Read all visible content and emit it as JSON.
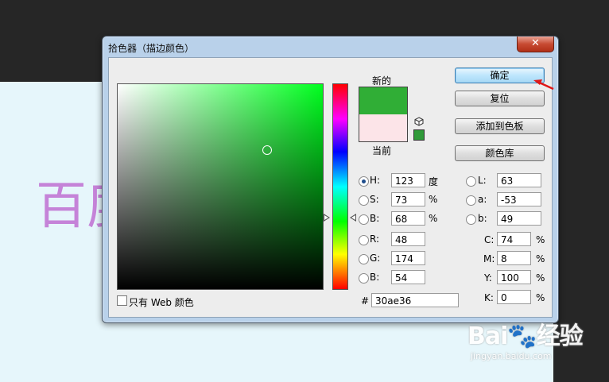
{
  "background": {
    "text": "百度"
  },
  "dialog": {
    "title": "拾色器（描边颜色）",
    "close_label": "✕",
    "new_label": "新的",
    "current_label": "当前",
    "new_color": "#30ae36",
    "current_color": "#fce4e8",
    "gamut_color": "#2f9a39",
    "buttons": {
      "ok": "确定",
      "reset": "复位",
      "add_swatch": "添加到色板",
      "libraries": "颜色库"
    },
    "hsb": [
      {
        "label": "H:",
        "value": "123",
        "unit": "度",
        "checked": true
      },
      {
        "label": "S:",
        "value": "73",
        "unit": "%",
        "checked": false
      },
      {
        "label": "B:",
        "value": "68",
        "unit": "%",
        "checked": false
      }
    ],
    "rgb": [
      {
        "label": "R:",
        "value": "48"
      },
      {
        "label": "G:",
        "value": "174"
      },
      {
        "label": "B:",
        "value": "54"
      }
    ],
    "lab": [
      {
        "label": "L:",
        "value": "63"
      },
      {
        "label": "a:",
        "value": "-53"
      },
      {
        "label": "b:",
        "value": "49"
      }
    ],
    "cmyk": [
      {
        "label": "C:",
        "value": "74",
        "unit": "%"
      },
      {
        "label": "M:",
        "value": "8",
        "unit": "%"
      },
      {
        "label": "Y:",
        "value": "100",
        "unit": "%"
      },
      {
        "label": "K:",
        "value": "0",
        "unit": "%"
      }
    ],
    "hex_label": "#",
    "hex_value": "30ae36",
    "web_only_label": "只有 Web 颜色",
    "saturation": 0.73,
    "brightness": 0.68,
    "hue_level": 0.342
  },
  "watermark": {
    "main": "Bai🐾经验",
    "sub": "jingyan.baidu.com"
  }
}
